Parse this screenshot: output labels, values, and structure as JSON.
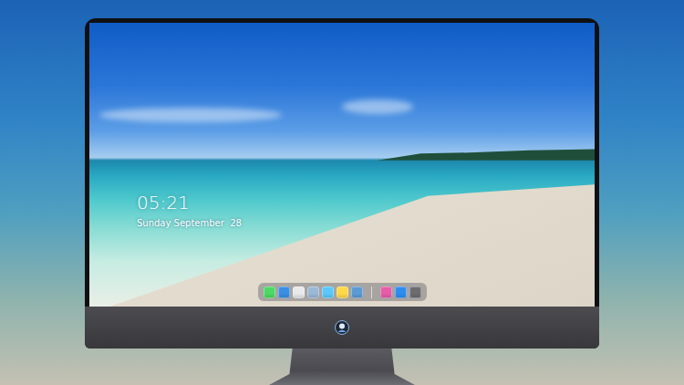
{
  "clock": {
    "time": "05:21",
    "date": "Sunday September  28"
  },
  "dock": {
    "items": [
      {
        "kind": "app",
        "color": "#4cd964"
      },
      {
        "kind": "app",
        "color": "#3a8ee6"
      },
      {
        "kind": "app",
        "color": "#e9e9e9"
      },
      {
        "kind": "app",
        "color": "#9cb8d6"
      },
      {
        "kind": "app",
        "color": "#5ac8fa"
      },
      {
        "kind": "app",
        "color": "#ffd84a"
      },
      {
        "kind": "app",
        "color": "#5b9bd5"
      },
      {
        "kind": "separator"
      },
      {
        "kind": "app",
        "color": "#e45ea8"
      },
      {
        "kind": "app",
        "color": "#2f8cf0"
      },
      {
        "kind": "app",
        "color": "#6b6b70"
      }
    ]
  }
}
